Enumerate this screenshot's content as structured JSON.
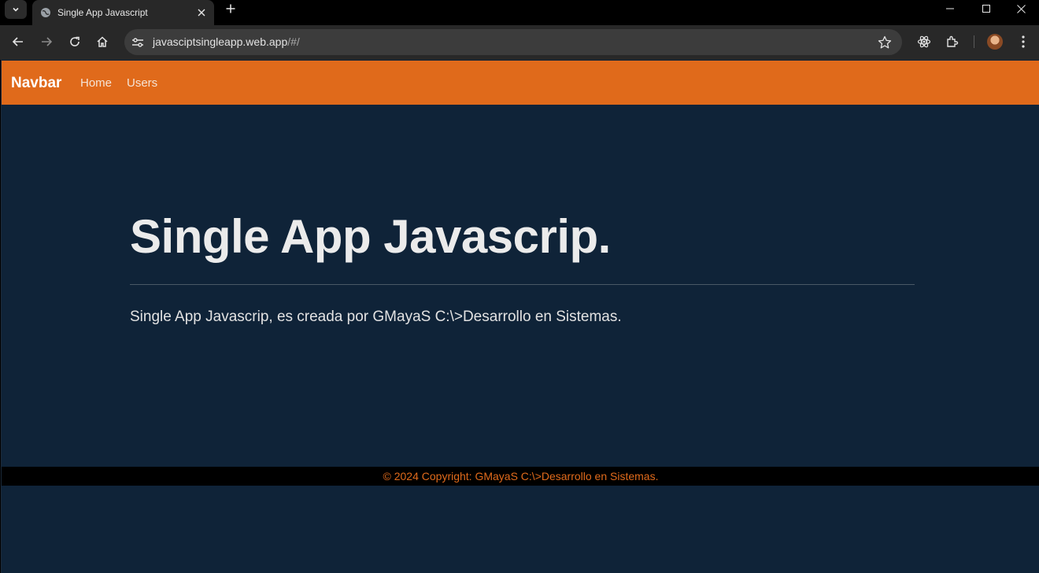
{
  "browser": {
    "tab_title": "Single App Javascript",
    "url_host": "javasciptsingleapp.web.app",
    "url_path": "/#/",
    "icons": [
      "tab-search-icon",
      "globe-icon",
      "close-icon",
      "plus-icon",
      "minimize-icon",
      "maximize-icon",
      "window-close-icon",
      "back-icon",
      "forward-icon",
      "reload-icon",
      "home-icon",
      "tune-icon",
      "star-icon",
      "react-extension-icon",
      "extensions-icon",
      "profile-avatar",
      "more-icon"
    ]
  },
  "navbar": {
    "brand": "Navbar",
    "links": [
      "Home",
      "Users"
    ],
    "color": "#e06a1b"
  },
  "hero": {
    "title": "Single App Javascrip.",
    "lead": "Single App Javascrip, es creada por GMayaS C:\\>Desarrollo en Sistemas."
  },
  "footer": {
    "text": "© 2024 Copyright: GMayaS C:\\>Desarrollo en Sistemas."
  },
  "colors": {
    "page_bg": "#0f2338",
    "accent": "#e06a1b",
    "footer_bg": "#000000"
  }
}
